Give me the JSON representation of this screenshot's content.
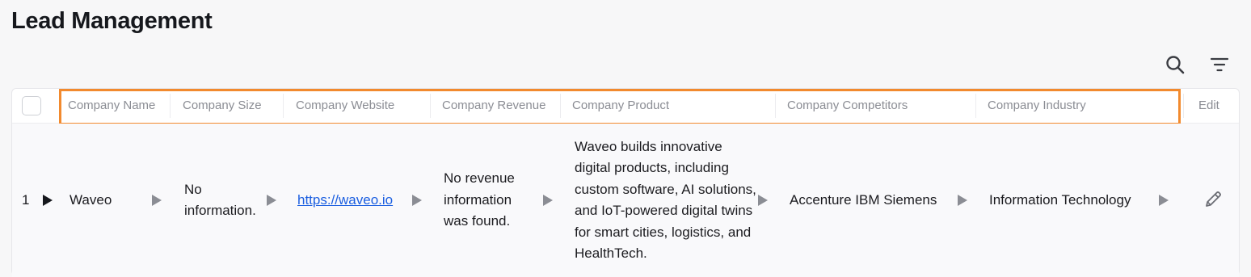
{
  "page": {
    "title": "Lead Management"
  },
  "toolbar": {
    "search_icon": "search-icon",
    "filter_icon": "filter-icon"
  },
  "table": {
    "columns": [
      "Company Name",
      "Company Size",
      "Company Website",
      "Company Revenue",
      "Company Product",
      "Company Competitors",
      "Company Industry",
      "Edit"
    ],
    "rows": [
      {
        "index": "1",
        "company_name": "Waveo",
        "company_size": "No information.",
        "company_website": "https://waveo.io",
        "company_revenue": "No revenue information was found.",
        "company_product": "Waveo builds innovative digital products, including custom software, AI solutions, and IoT-powered digital twins for smart cities, logistics, and HealthTech.",
        "company_competitors": "Accenture IBM Siemens",
        "company_industry": "Information Technology"
      }
    ]
  },
  "colors": {
    "highlight": "#f28a2e",
    "link": "#1a5ee0"
  }
}
